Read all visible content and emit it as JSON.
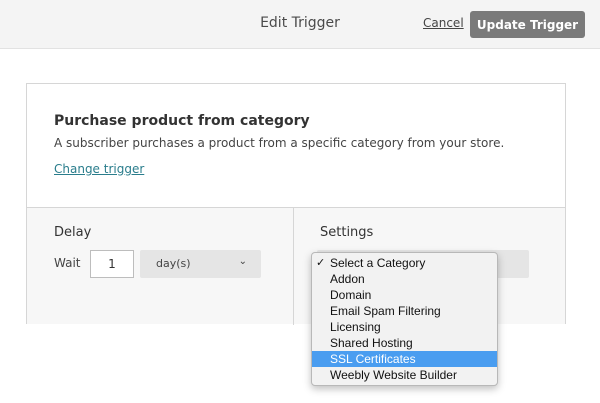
{
  "header": {
    "title": "Edit Trigger",
    "cancel_label": "Cancel",
    "update_label": "Update Trigger"
  },
  "trigger": {
    "title": "Purchase product from category",
    "description": "A subscriber purchases a product from a specific category from your store.",
    "change_link": "Change trigger"
  },
  "delay": {
    "heading": "Delay",
    "wait_label": "Wait",
    "wait_value": "1",
    "unit": "day(s)",
    "unit_icon": "chevron-down-icon"
  },
  "settings": {
    "heading": "Settings",
    "category_options": [
      {
        "label": "Select a Category",
        "checked": true,
        "highlighted": false
      },
      {
        "label": "Addon",
        "checked": false,
        "highlighted": false
      },
      {
        "label": "Domain",
        "checked": false,
        "highlighted": false
      },
      {
        "label": "Email Spam Filtering",
        "checked": false,
        "highlighted": false
      },
      {
        "label": "Licensing",
        "checked": false,
        "highlighted": false
      },
      {
        "label": "Shared Hosting",
        "checked": false,
        "highlighted": false
      },
      {
        "label": "SSL Certificates",
        "checked": false,
        "highlighted": true
      },
      {
        "label": "Weebly Website Builder",
        "checked": false,
        "highlighted": false
      }
    ],
    "highlight_color": "#4a9df0"
  },
  "colors": {
    "update_button": "#7a7a7a",
    "link": "#2a7d8c"
  }
}
